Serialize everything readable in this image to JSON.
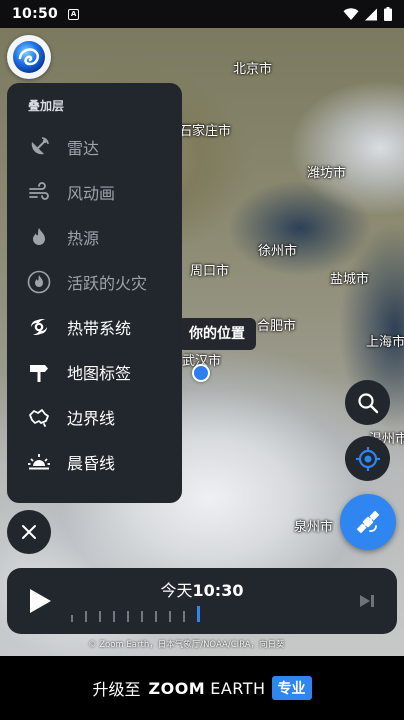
{
  "status_bar": {
    "time": "10:50",
    "app_badge": "A"
  },
  "map": {
    "cities": [
      {
        "name": "北京市",
        "key": "beijing"
      },
      {
        "name": "石家庄市",
        "key": "shijiazhuang"
      },
      {
        "name": "潍坊市",
        "key": "weifang"
      },
      {
        "name": "徐州市",
        "key": "xuzhou"
      },
      {
        "name": "周口市",
        "key": "zhoukou"
      },
      {
        "name": "盐城市",
        "key": "yancheng"
      },
      {
        "name": "合肥市",
        "key": "hefei"
      },
      {
        "name": "上海市",
        "key": "shanghai"
      },
      {
        "name": "武汉市",
        "key": "wuhan"
      },
      {
        "name": "温州市",
        "key": "wenzhou"
      },
      {
        "name": "泉州市",
        "key": "quanzhou"
      }
    ],
    "location_tooltip": "你的位置",
    "attribution": "© Zoom Earth，日本气象厅/NOAA/CIRA，向日葵"
  },
  "overlay_panel": {
    "title": "叠加层",
    "layers": [
      {
        "label": "雷达",
        "icon": "radar-icon",
        "active": false
      },
      {
        "label": "风动画",
        "icon": "wind-icon",
        "active": false
      },
      {
        "label": "热源",
        "icon": "flame-icon",
        "active": false
      },
      {
        "label": "活跃的火灾",
        "icon": "active-fire-icon",
        "active": false
      },
      {
        "label": "热带系统",
        "icon": "hurricane-icon",
        "active": true
      },
      {
        "label": "地图标签",
        "icon": "signpost-icon",
        "active": true
      },
      {
        "label": "边界线",
        "icon": "boundary-icon",
        "active": true
      },
      {
        "label": "晨昏线",
        "icon": "sunrise-icon",
        "active": true
      }
    ]
  },
  "timeline": {
    "day": "今天",
    "time": "10:30"
  },
  "upgrade": {
    "prefix": "升级至",
    "brand_bold": "ZOOM",
    "brand_light": "EARTH",
    "badge": "专业"
  },
  "colors": {
    "panel_bg": "#22262d",
    "accent_blue": "#2f86f0",
    "inactive_text": "#9ea3aa"
  }
}
